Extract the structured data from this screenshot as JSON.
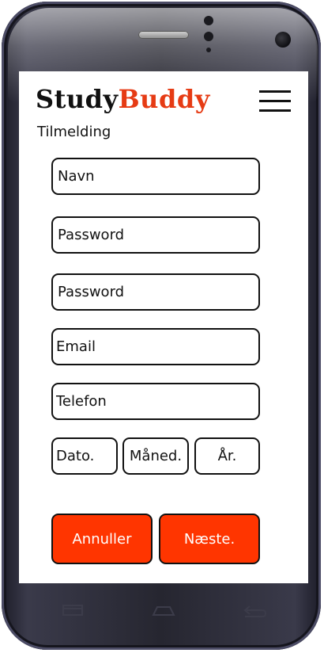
{
  "app": {
    "logo_part1": "StudyBuddy",
    "logo_study": "Study",
    "logo_buddy": "Buddy",
    "heading": "Tilmelding"
  },
  "form": {
    "name_placeholder": "Navn",
    "password_placeholder": "Password",
    "password_repeat_placeholder": "Password",
    "email_placeholder": "Email",
    "phone_placeholder": "Telefon",
    "day_placeholder": "Dato.",
    "month_placeholder": "Måned.",
    "year_placeholder": "År."
  },
  "buttons": {
    "cancel_label": "Annuller",
    "next_label": "Næste."
  },
  "colors": {
    "accent": "#ff3500",
    "logo_buddy": "#e63b14",
    "screen_bg": "#ffffff"
  },
  "icons": {
    "menu": "hamburger-icon",
    "nav_recent": "recent-apps-icon",
    "nav_home": "home-icon",
    "nav_back": "back-icon"
  }
}
